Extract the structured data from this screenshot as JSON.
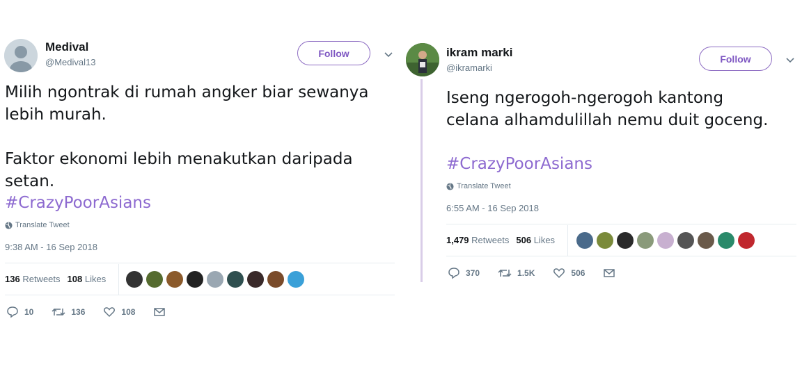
{
  "left_tweet": {
    "display_name": "Medival",
    "handle": "@Medival13",
    "follow_label": "Follow",
    "text_lines": [
      "Milih ngontrak di rumah angker biar sewanya",
      "lebih murah.",
      "",
      "Faktor ekonomi lebih menakutkan daripada",
      "setan."
    ],
    "hashtag": "#CrazyPoorAsians",
    "translate_label": "Translate Tweet",
    "timestamp": "9:38 AM - 16 Sep 2018",
    "retweets_count": "136",
    "retweets_label": "Retweets",
    "likes_count": "108",
    "likes_label": "Likes",
    "liker_avatar_colors": [
      "#333333",
      "#556b2f",
      "#8b5a2b",
      "#222222",
      "#9aa7b2",
      "#2f4f4f",
      "#3a2a2a",
      "#7a4b2a",
      "#3aa0d8"
    ],
    "reply_count": "10",
    "retweet_count": "136",
    "like_count": "108",
    "icons": {
      "reply": "reply-icon",
      "retweet": "retweet-icon",
      "like": "heart-icon",
      "dm": "envelope-icon",
      "caret": "chevron-down-icon",
      "globe": "globe-icon"
    }
  },
  "right_tweet": {
    "display_name": "ikram marki",
    "handle": "@ikramarki",
    "follow_label": "Follow",
    "text_lines": [
      "Iseng ngerogoh-ngerogoh kantong",
      "celana alhamdulillah nemu duit goceng."
    ],
    "hashtag": "#CrazyPoorAsians",
    "translate_label": "Translate Tweet",
    "timestamp": "6:55 AM - 16 Sep 2018",
    "retweets_count": "1,479",
    "retweets_label": "Retweets",
    "likes_count": "506",
    "likes_label": "Likes",
    "liker_avatar_colors": [
      "#4a6a8a",
      "#7a8a3a",
      "#2a2a2a",
      "#8a9a7a",
      "#c8b0d0",
      "#555555",
      "#6a5a4a",
      "#2a8a6a",
      "#c0282e"
    ],
    "reply_count": "370",
    "retweet_count": "1.5K",
    "like_count": "506",
    "icons": {
      "reply": "reply-icon",
      "retweet": "retweet-icon",
      "like": "heart-icon",
      "dm": "envelope-icon",
      "caret": "chevron-down-icon",
      "globe": "globe-icon"
    }
  },
  "colors": {
    "accent": "#8d6ad0",
    "muted": "#657786",
    "text": "#14171a",
    "thread": "#d9cde8"
  }
}
